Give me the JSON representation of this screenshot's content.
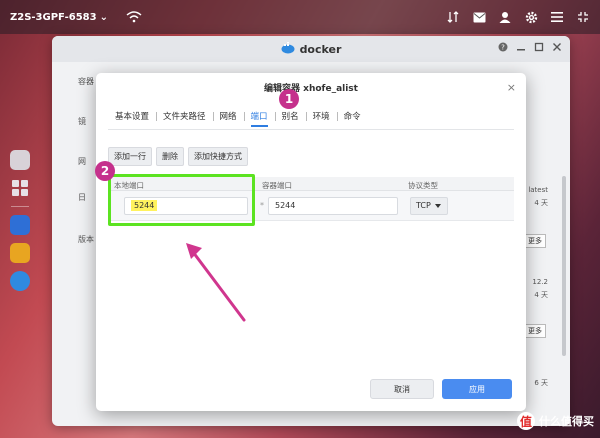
{
  "taskbar": {
    "host": "Z2S-3GPF-6583",
    "caret": "⌄"
  },
  "window": {
    "title": "docker",
    "left_labels": [
      "容器",
      "镜",
      "网",
      "日",
      "版本"
    ],
    "right_labels": [
      "latest",
      "4 天",
      "更多",
      "12.2",
      "4 天",
      "更多",
      "6 天"
    ]
  },
  "dialog": {
    "title": "编辑容器 xhofe_alist",
    "close": "×",
    "tabs": [
      {
        "label": "基本设置"
      },
      {
        "label": "文件夹路径"
      },
      {
        "label": "网络"
      },
      {
        "label": "端口"
      },
      {
        "label": "别名"
      },
      {
        "label": "环境"
      },
      {
        "label": "命令"
      }
    ],
    "active_tab": "端口",
    "toolbar": {
      "add_row": "添加一行",
      "delete": "删除",
      "add_shortcut": "添加快捷方式"
    },
    "table": {
      "headers": [
        "本地端口",
        "容器端口",
        "协议类型"
      ],
      "rows": [
        {
          "local_port": "5244",
          "container_port": "5244",
          "protocol": "TCP"
        }
      ],
      "required_mark": "*"
    },
    "footer": {
      "cancel": "取消",
      "apply": "应用"
    }
  },
  "annotations": {
    "marker_1": "1",
    "marker_2": "2",
    "accent_green": "#5ce321",
    "accent_pink": "#c5318c"
  },
  "watermark": {
    "logo": "值",
    "text": "什么值得买"
  },
  "colors": {
    "primary": "#4a8cf0",
    "tab_active": "#2e7de1",
    "highlight": "#fff25e"
  }
}
